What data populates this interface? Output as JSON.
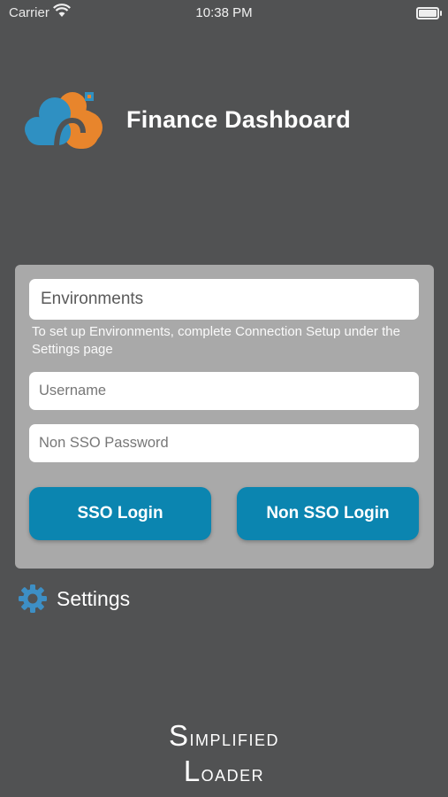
{
  "status_bar": {
    "carrier": "Carrier",
    "time": "10:38 PM"
  },
  "header": {
    "title": "Finance Dashboard",
    "logo_icon": "cloud-logo-icon"
  },
  "login": {
    "environment_label": "Environments",
    "hint": "To set up Environments, complete Connection Setup under the Settings page",
    "username_placeholder": "Username",
    "password_placeholder": "Non SSO Password",
    "sso_button": "SSO Login",
    "non_sso_button": "Non SSO Login"
  },
  "settings": {
    "label": "Settings",
    "icon": "gear-icon"
  },
  "footer": {
    "line1_first": "S",
    "line1_rest": "implified",
    "line2_first": "L",
    "line2_rest": "oader"
  },
  "colors": {
    "background": "#515253",
    "card": "#a9a9a9",
    "button": "#0b85b0",
    "logo_blue": "#2f90c2",
    "logo_orange": "#e8852c"
  }
}
